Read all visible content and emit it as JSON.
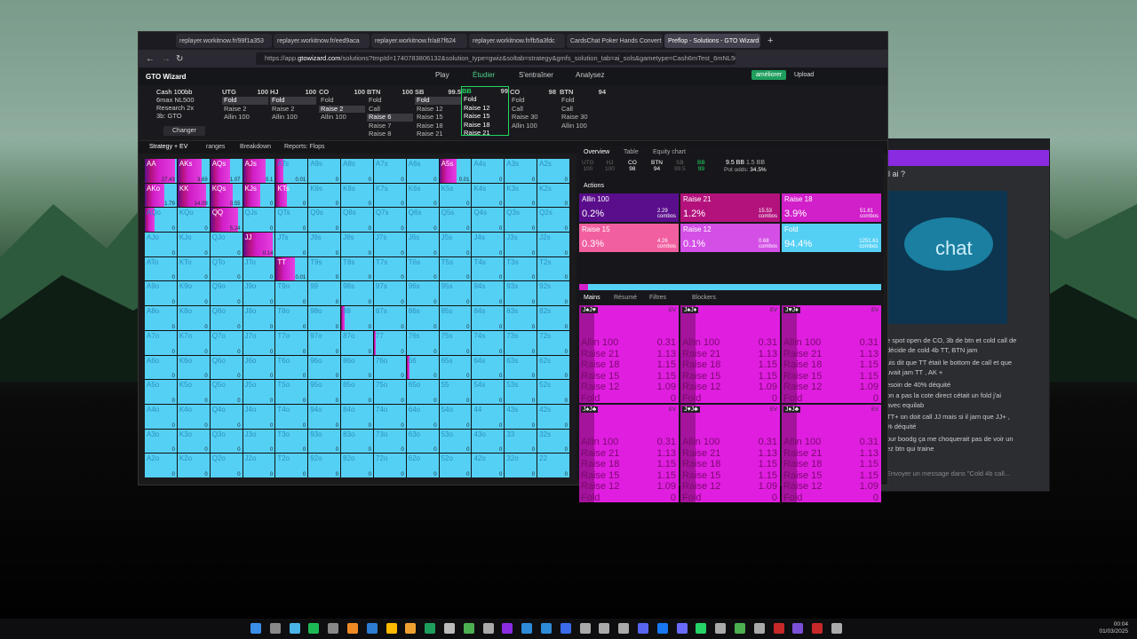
{
  "browser": {
    "tabs": [
      {
        "label": "replayer.workitnow.fr/99f1a353"
      },
      {
        "label": "replayer.workitnow.fr/eed9aca"
      },
      {
        "label": "replayer.workitnow.fr/a87f624"
      },
      {
        "label": "replayer.workitnow.fr/fb5a3fdc"
      },
      {
        "label": "CardsChat Poker Hands Convert"
      },
      {
        "label": "Preflop - Solutions - GTO Wizard"
      }
    ],
    "url_prefix": "https://app.",
    "url_host": "gtowizard.com",
    "url_rest": "/solutions?tmpId=1740783806132&solution_type=gwiz&soltab=strategy&gmfs_solution_tab=ai_sols&gametype=Cash6mTest_6mNL500R2&depth"
  },
  "app": {
    "logo": "GTO Wizard",
    "nav": [
      "Play",
      "Étudier",
      "S'entraîner",
      "Analysez"
    ],
    "ameliorer": "améliorer",
    "upload": "Upload"
  },
  "settings": {
    "game": "Cash 100bb",
    "lines": [
      "6max NL500",
      "Research 2x",
      "3b: GTO"
    ],
    "changer": "Changer"
  },
  "positions": [
    {
      "name": "UTG",
      "stack": "100",
      "options": [
        "Fold",
        "Raise 2",
        "Allin 100"
      ],
      "sel": 0
    },
    {
      "name": "HJ",
      "stack": "100",
      "options": [
        "Fold",
        "Raise 2",
        "Allin 100"
      ],
      "sel": 0
    },
    {
      "name": "CO",
      "stack": "100",
      "options": [
        "Fold",
        "Raise 2",
        "Allin 100"
      ],
      "sel": 1
    },
    {
      "name": "BTN",
      "stack": "100",
      "options": [
        "Fold",
        "Call",
        "Raise 6",
        "Raise 7",
        "Raise 8"
      ],
      "sel": 2
    },
    {
      "name": "SB",
      "stack": "99.5",
      "options": [
        "Fold",
        "Raise 12",
        "Raise 15",
        "Raise 18",
        "Raise 21"
      ],
      "sel": 0
    },
    {
      "name": "BB",
      "stack": "99",
      "options": [
        "Fold",
        "Raise 12",
        "Raise 15",
        "Raise 18",
        "Raise 21"
      ],
      "sel": -1
    },
    {
      "name": "CO",
      "stack": "98",
      "options": [
        "Fold",
        "Call",
        "Raise 30",
        "Allin 100"
      ],
      "sel": -1
    },
    {
      "name": "BTN",
      "stack": "94",
      "options": [
        "Fold",
        "Call",
        "Raise 30",
        "Allin 100"
      ],
      "sel": -1
    }
  ],
  "menu": {
    "strategy": "Strategy + EV",
    "ranges": "ranges",
    "breakdown": "Breakdown",
    "reports": "Reports: Flops"
  },
  "grid": {
    "ranks": [
      "A",
      "K",
      "Q",
      "J",
      "T",
      "9",
      "8",
      "7",
      "6",
      "5",
      "4",
      "3",
      "2"
    ],
    "special": {
      "AA": {
        "mix": 0.95,
        "ev": "27.43"
      },
      "AKs": {
        "mix": 0.75,
        "ev": "3.69"
      },
      "AQs": {
        "mix": 0.62,
        "ev": "1.07"
      },
      "AJs": {
        "mix": 0.7,
        "ev": "0.1"
      },
      "ATs": {
        "mix": 0.25,
        "ev": "0.01"
      },
      "A5s": {
        "mix": 0.55,
        "ev": "0.01"
      },
      "AKo": {
        "mix": 0.6,
        "ev": "1.79"
      },
      "KK": {
        "mix": 0.9,
        "ev": "14.09"
      },
      "KQs": {
        "mix": 0.7,
        "ev": "0.55"
      },
      "KJs": {
        "mix": 0.55,
        "ev": "0"
      },
      "KTs": {
        "mix": 0.35,
        "ev": "0"
      },
      "AQo": {
        "mix": 0.3,
        "ev": "0"
      },
      "QQ": {
        "mix": 0.88,
        "ev": "5.24"
      },
      "JJ": {
        "mix": 0.94,
        "ev": "0.14"
      },
      "TT": {
        "mix": 0.6,
        "ev": "0.01"
      },
      "88": {
        "mix": 0.12,
        "ev": "0"
      },
      "77": {
        "mix": 0.05,
        "ev": "0"
      },
      "66": {
        "mix": 0.1,
        "ev": "0"
      }
    }
  },
  "right_panel": {
    "tabs": [
      "Overview",
      "Table",
      "Equity chart"
    ],
    "seats": [
      {
        "name": "UTG",
        "val": "100"
      },
      {
        "name": "HJ",
        "val": "100"
      },
      {
        "name": "CO",
        "val": "98"
      },
      {
        "name": "BTN",
        "val": "94"
      },
      {
        "name": "SB",
        "val": "99.5"
      },
      {
        "name": "BB",
        "val": "99"
      }
    ],
    "pot": "9.5 BB",
    "pot_bb": "1.5 BB",
    "pot_odds_label": "Pot odds:",
    "pot_odds": "34.5%",
    "actions_label": "Actions",
    "actions": [
      {
        "name": "Allin 100",
        "pct": "0.2%",
        "combos": "2.29",
        "color": "#5a0e8c"
      },
      {
        "name": "Raise 21",
        "pct": "1.2%",
        "combos": "15.53",
        "color": "#b3127c"
      },
      {
        "name": "Raise 18",
        "pct": "3.9%",
        "combos": "51.81",
        "color": "#d11fc9"
      },
      {
        "name": "Raise 15",
        "pct": "0.3%",
        "combos": "4.26",
        "color": "#f25fa0"
      },
      {
        "name": "Raise 12",
        "pct": "0.1%",
        "combos": "0.68",
        "color": "#d34fe6"
      },
      {
        "name": "Fold",
        "pct": "94.4%",
        "combos": "1251.61",
        "color": "#55d0f5"
      }
    ],
    "combos_word": "combos",
    "subtabs": [
      "Mains",
      "Résumé",
      "Filtres",
      "Blockers"
    ],
    "hands": [
      {
        "hand": "J♠J♥"
      },
      {
        "hand": "J♠J♦"
      },
      {
        "hand": "J♥J♦"
      },
      {
        "hand": "J♠J♣"
      },
      {
        "hand": "J♥J♣"
      },
      {
        "hand": "J♦J♣"
      }
    ],
    "hand_rows": [
      {
        "a": "Allin 100",
        "v": "0.31"
      },
      {
        "a": "Raise 21",
        "v": "1.13"
      },
      {
        "a": "Raise 18",
        "v": "1.15"
      },
      {
        "a": "Raise 15",
        "v": "1.15"
      },
      {
        "a": "Raise 12",
        "v": "1.09"
      },
      {
        "a": "Fold",
        "v": "0"
      }
    ],
    "ev_label": "EV"
  },
  "chat": {
    "channel": "ll ai ?",
    "image_caption": "chat",
    "messages": [
      "e spot open de CO, 3b de btn et cold call de",
      "décide de cold 4b TT, BTN jam",
      "uis dit que TT était le bottom de call et que",
      "uvait jam TT , AK +",
      "esoin de 40% déquité",
      "on a pas la cote direct cétait un fold j'ai",
      "avec equilab",
      "TT+ on doit call JJ mais si il jam que JJ+ ,",
      "% déquité",
      "our boodg ça me choquerait pas de voir un",
      "ez btn qui traine"
    ],
    "input_placeholder": "Envoyer un message dans \"Cold 4b call..."
  },
  "clock": {
    "time": "00:04",
    "date": "01/03/2025"
  }
}
